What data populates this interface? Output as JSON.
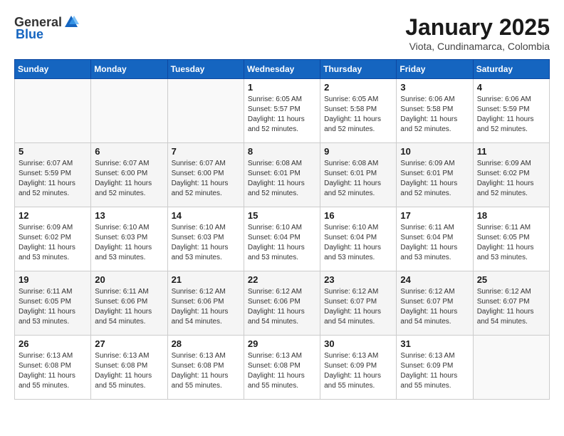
{
  "header": {
    "logo_general": "General",
    "logo_blue": "Blue",
    "month_title": "January 2025",
    "location": "Viota, Cundinamarca, Colombia"
  },
  "weekdays": [
    "Sunday",
    "Monday",
    "Tuesday",
    "Wednesday",
    "Thursday",
    "Friday",
    "Saturday"
  ],
  "weeks": [
    [
      {
        "day": "",
        "info": ""
      },
      {
        "day": "",
        "info": ""
      },
      {
        "day": "",
        "info": ""
      },
      {
        "day": "1",
        "info": "Sunrise: 6:05 AM\nSunset: 5:57 PM\nDaylight: 11 hours\nand 52 minutes."
      },
      {
        "day": "2",
        "info": "Sunrise: 6:05 AM\nSunset: 5:58 PM\nDaylight: 11 hours\nand 52 minutes."
      },
      {
        "day": "3",
        "info": "Sunrise: 6:06 AM\nSunset: 5:58 PM\nDaylight: 11 hours\nand 52 minutes."
      },
      {
        "day": "4",
        "info": "Sunrise: 6:06 AM\nSunset: 5:59 PM\nDaylight: 11 hours\nand 52 minutes."
      }
    ],
    [
      {
        "day": "5",
        "info": "Sunrise: 6:07 AM\nSunset: 5:59 PM\nDaylight: 11 hours\nand 52 minutes."
      },
      {
        "day": "6",
        "info": "Sunrise: 6:07 AM\nSunset: 6:00 PM\nDaylight: 11 hours\nand 52 minutes."
      },
      {
        "day": "7",
        "info": "Sunrise: 6:07 AM\nSunset: 6:00 PM\nDaylight: 11 hours\nand 52 minutes."
      },
      {
        "day": "8",
        "info": "Sunrise: 6:08 AM\nSunset: 6:01 PM\nDaylight: 11 hours\nand 52 minutes."
      },
      {
        "day": "9",
        "info": "Sunrise: 6:08 AM\nSunset: 6:01 PM\nDaylight: 11 hours\nand 52 minutes."
      },
      {
        "day": "10",
        "info": "Sunrise: 6:09 AM\nSunset: 6:01 PM\nDaylight: 11 hours\nand 52 minutes."
      },
      {
        "day": "11",
        "info": "Sunrise: 6:09 AM\nSunset: 6:02 PM\nDaylight: 11 hours\nand 52 minutes."
      }
    ],
    [
      {
        "day": "12",
        "info": "Sunrise: 6:09 AM\nSunset: 6:02 PM\nDaylight: 11 hours\nand 53 minutes."
      },
      {
        "day": "13",
        "info": "Sunrise: 6:10 AM\nSunset: 6:03 PM\nDaylight: 11 hours\nand 53 minutes."
      },
      {
        "day": "14",
        "info": "Sunrise: 6:10 AM\nSunset: 6:03 PM\nDaylight: 11 hours\nand 53 minutes."
      },
      {
        "day": "15",
        "info": "Sunrise: 6:10 AM\nSunset: 6:04 PM\nDaylight: 11 hours\nand 53 minutes."
      },
      {
        "day": "16",
        "info": "Sunrise: 6:10 AM\nSunset: 6:04 PM\nDaylight: 11 hours\nand 53 minutes."
      },
      {
        "day": "17",
        "info": "Sunrise: 6:11 AM\nSunset: 6:04 PM\nDaylight: 11 hours\nand 53 minutes."
      },
      {
        "day": "18",
        "info": "Sunrise: 6:11 AM\nSunset: 6:05 PM\nDaylight: 11 hours\nand 53 minutes."
      }
    ],
    [
      {
        "day": "19",
        "info": "Sunrise: 6:11 AM\nSunset: 6:05 PM\nDaylight: 11 hours\nand 53 minutes."
      },
      {
        "day": "20",
        "info": "Sunrise: 6:11 AM\nSunset: 6:06 PM\nDaylight: 11 hours\nand 54 minutes."
      },
      {
        "day": "21",
        "info": "Sunrise: 6:12 AM\nSunset: 6:06 PM\nDaylight: 11 hours\nand 54 minutes."
      },
      {
        "day": "22",
        "info": "Sunrise: 6:12 AM\nSunset: 6:06 PM\nDaylight: 11 hours\nand 54 minutes."
      },
      {
        "day": "23",
        "info": "Sunrise: 6:12 AM\nSunset: 6:07 PM\nDaylight: 11 hours\nand 54 minutes."
      },
      {
        "day": "24",
        "info": "Sunrise: 6:12 AM\nSunset: 6:07 PM\nDaylight: 11 hours\nand 54 minutes."
      },
      {
        "day": "25",
        "info": "Sunrise: 6:12 AM\nSunset: 6:07 PM\nDaylight: 11 hours\nand 54 minutes."
      }
    ],
    [
      {
        "day": "26",
        "info": "Sunrise: 6:13 AM\nSunset: 6:08 PM\nDaylight: 11 hours\nand 55 minutes."
      },
      {
        "day": "27",
        "info": "Sunrise: 6:13 AM\nSunset: 6:08 PM\nDaylight: 11 hours\nand 55 minutes."
      },
      {
        "day": "28",
        "info": "Sunrise: 6:13 AM\nSunset: 6:08 PM\nDaylight: 11 hours\nand 55 minutes."
      },
      {
        "day": "29",
        "info": "Sunrise: 6:13 AM\nSunset: 6:08 PM\nDaylight: 11 hours\nand 55 minutes."
      },
      {
        "day": "30",
        "info": "Sunrise: 6:13 AM\nSunset: 6:09 PM\nDaylight: 11 hours\nand 55 minutes."
      },
      {
        "day": "31",
        "info": "Sunrise: 6:13 AM\nSunset: 6:09 PM\nDaylight: 11 hours\nand 55 minutes."
      },
      {
        "day": "",
        "info": ""
      }
    ]
  ]
}
